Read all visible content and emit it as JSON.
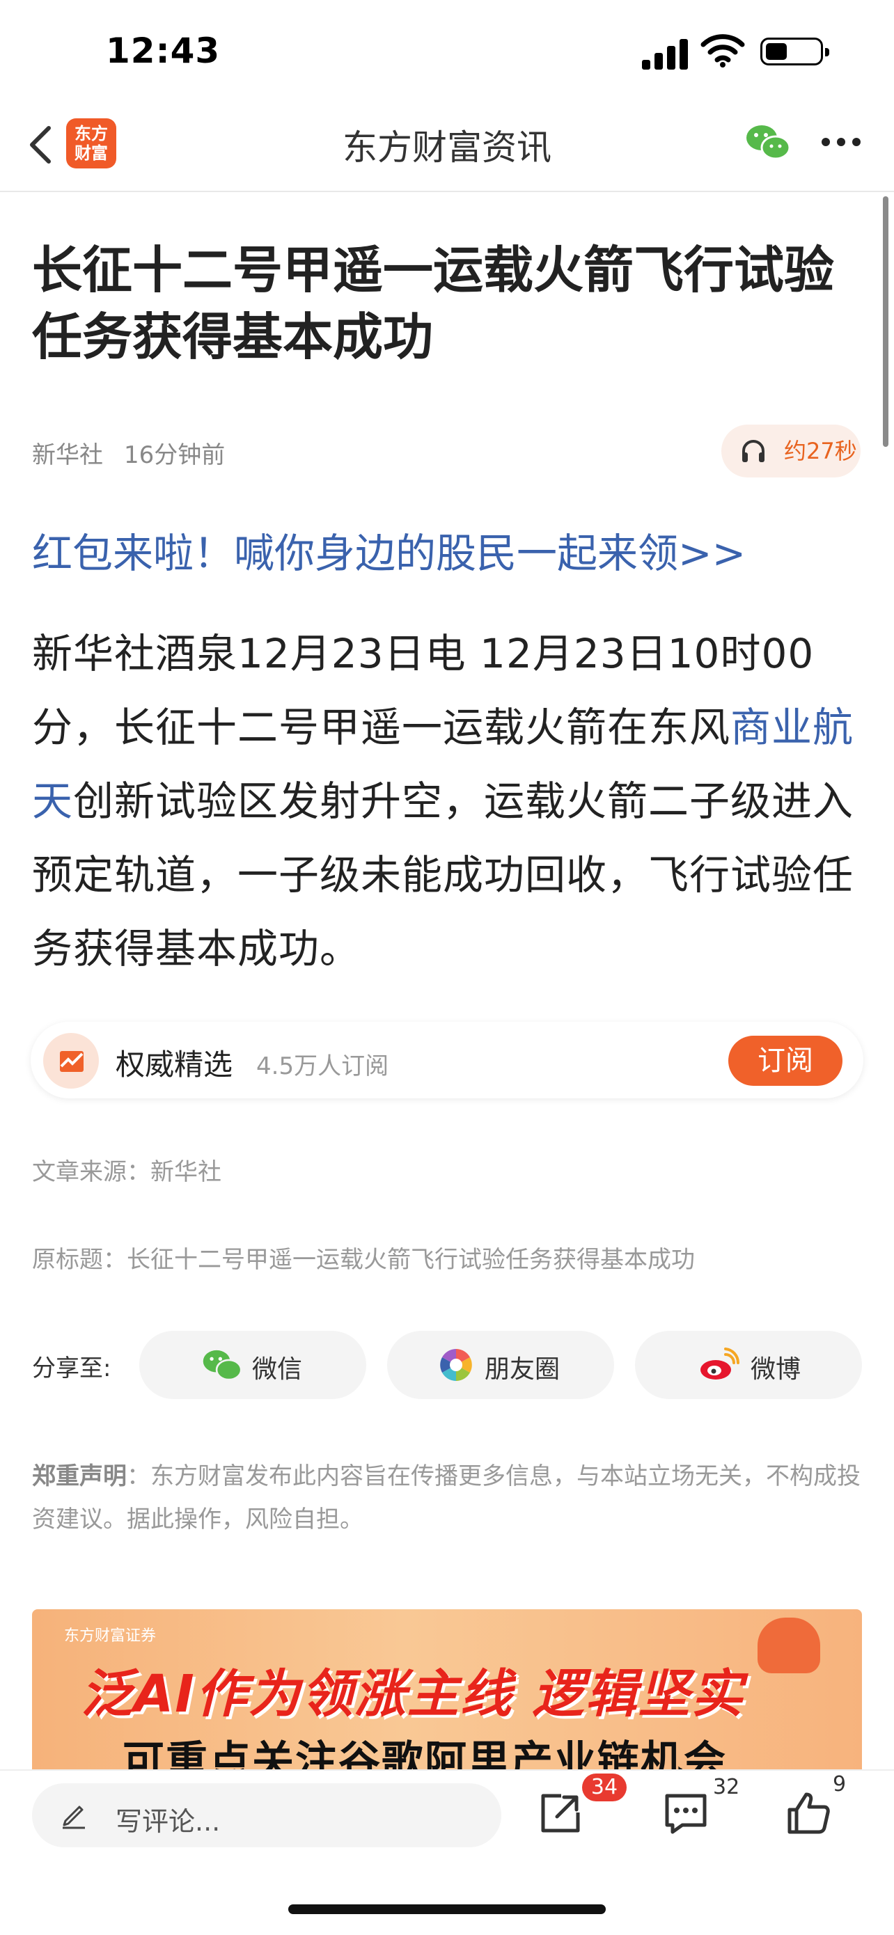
{
  "status_bar": {
    "time": "12:43"
  },
  "nav": {
    "logo_line1": "东方",
    "logo_line2": "财富",
    "title": "东方财富资讯"
  },
  "article": {
    "headline": "长征十二号甲遥一运载火箭飞行试验任务获得基本成功",
    "publisher": "新华社",
    "time_ago": "16分钟前",
    "audio_duration": "约27秒",
    "promo_link": "红包来啦！喊你身边的股民一起来领>>",
    "body_part1": "新华社酒泉12月23日电  12月23日10时00分，长征十二号甲遥一运载火箭在东风",
    "body_link": "商业航天",
    "body_part2": "创新试验区发射升空，运载火箭二子级进入预定轨道，一子级未能成功回收，飞行试验任务获得基本成功。"
  },
  "subscription": {
    "name": "权威精选",
    "subscribers": "4.5万人订阅",
    "button": "订阅"
  },
  "source_line": "文章来源：新华社",
  "original_title_line": "原标题：长征十二号甲遥一运载火箭飞行试验任务获得基本成功",
  "share": {
    "label": "分享至:",
    "wechat": "微信",
    "moments": "朋友圈",
    "weibo": "微博"
  },
  "disclaimer": {
    "title": "郑重声明",
    "text": "：东方财富发布此内容旨在传播更多信息，与本站立场无关，不构成投资建议。据此操作，风险自担。"
  },
  "banner": {
    "brand": "东方财富证券",
    "headline": "泛AI作为领涨主线 逻辑坚实",
    "subline": "可重点关注谷歌阿里产业链机会"
  },
  "bottom_bar": {
    "comment_placeholder": "写评论...",
    "share_count": "34",
    "comment_count": "32",
    "like_count": "9"
  },
  "colors": {
    "accent_orange": "#f0612a",
    "link_blue": "#3a62ad",
    "badge_red": "#e83a30"
  }
}
